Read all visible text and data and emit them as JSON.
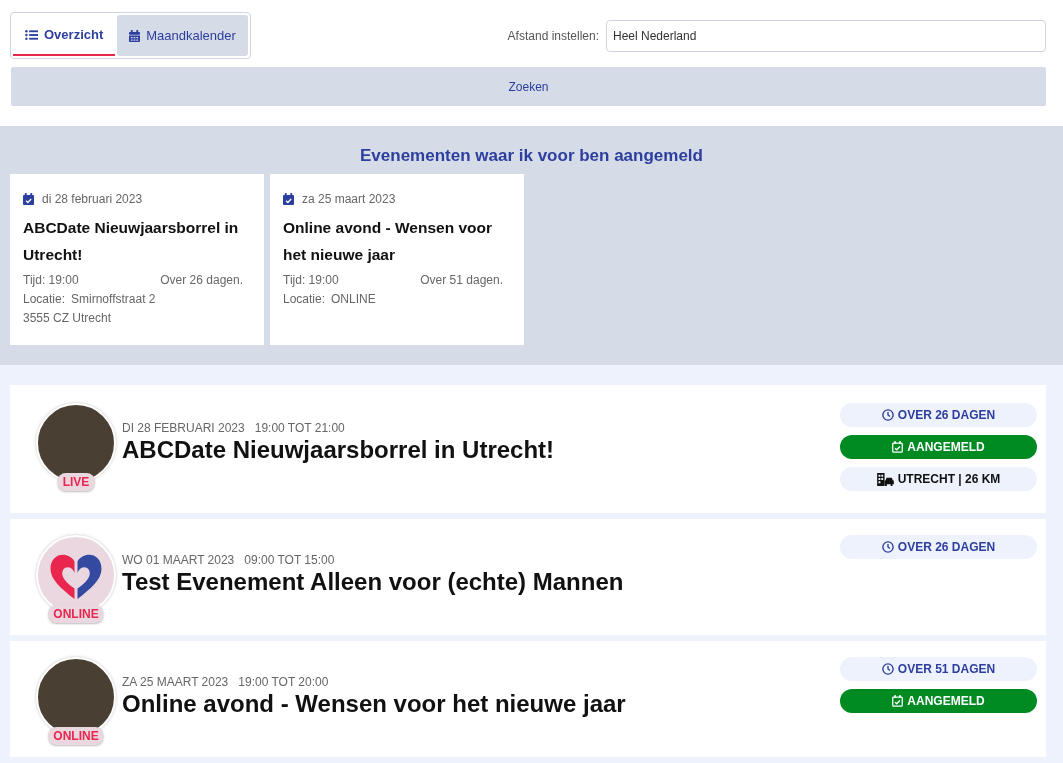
{
  "view_tabs": [
    {
      "label": "Overzicht",
      "selected": true
    },
    {
      "label": "Maandkalender",
      "selected": false
    }
  ],
  "distance": {
    "label": "Afstand instellen:",
    "value": "Heel Nederland"
  },
  "search_button": "Zoeken",
  "registered": {
    "title": "Evenementen waar ik voor ben aangemeld",
    "cards": [
      {
        "date": "di 28 februari 2023",
        "title": "ABCDate Nieuwjaarsborrel in Utrecht!",
        "time": "Tijd: 19:00",
        "countdown": "Over 26 dagen.",
        "location_label": "Locatie:",
        "location_lines": [
          "Smirnoffstraat 2",
          "3555 CZ Utrecht"
        ]
      },
      {
        "date": "za 25 maart 2023",
        "title": "Online avond - Wensen voor het nieuwe jaar",
        "time": "Tijd: 19:00",
        "countdown": "Over 51 dagen.",
        "location_label": "Locatie:",
        "location_lines": [
          "ONLINE"
        ]
      }
    ]
  },
  "events": [
    {
      "kind": "photo",
      "tag": "LIVE",
      "date": "DI 28 FEBRUARI 2023",
      "time": "19:00 TOT 21:00",
      "title": "ABCDate Nieuwjaarsborrel in Utrecht!",
      "badges": [
        {
          "kind": "countdown",
          "text": "OVER 26 DAGEN"
        },
        {
          "kind": "registered",
          "text": "AANGEMELD"
        },
        {
          "kind": "location",
          "text": "UTRECHT | 26 KM"
        }
      ]
    },
    {
      "kind": "logo",
      "tag": "ONLINE",
      "date": "WO 01 MAART 2023",
      "time": "09:00 TOT 15:00",
      "title": "Test Evenement Alleen voor (echte) Mannen",
      "badges": [
        {
          "kind": "countdown",
          "text": "OVER 26 DAGEN"
        }
      ]
    },
    {
      "kind": "photo",
      "tag": "ONLINE",
      "date": "ZA 25 MAART 2023",
      "time": "19:00 TOT 20:00",
      "title": "Online avond - Wensen voor het nieuwe jaar",
      "badges": [
        {
          "kind": "countdown",
          "text": "OVER 51 DAGEN"
        },
        {
          "kind": "registered",
          "text": "AANGEMELD"
        }
      ]
    }
  ]
}
